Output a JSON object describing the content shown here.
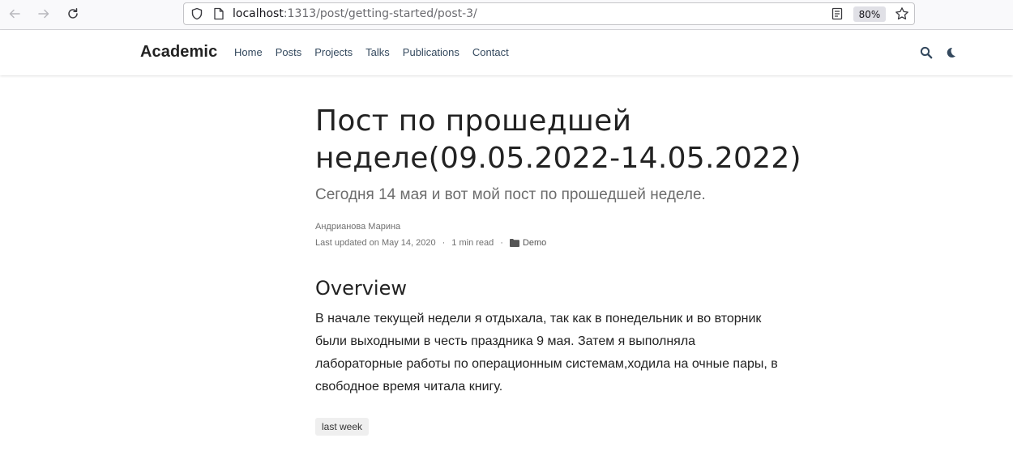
{
  "browser": {
    "url_host": "localhost",
    "url_path": ":1313/post/getting-started/post-3/",
    "zoom": "80%",
    "icons": [
      "back-icon",
      "forward-icon",
      "reload-icon",
      "shield-icon",
      "page-icon",
      "reader-view-icon",
      "bookmark-star-icon"
    ]
  },
  "site": {
    "brand": "Academic",
    "menu": [
      "Home",
      "Posts",
      "Projects",
      "Talks",
      "Publications",
      "Contact"
    ],
    "icons": [
      "search-icon",
      "moon-icon"
    ]
  },
  "article": {
    "title": "Пост по прошедшей неделе(09.05.2022-14.05.2022)",
    "subtitle": "Сегодня 14 мая и вот мой пост по прошедшей неделе.",
    "author": "Андрианова Марина",
    "updated": "Last updated on May 14, 2020",
    "read_time": "1 min read",
    "separator": "·",
    "category": "Demo",
    "section_heading": "Overview",
    "body": "В начале текущей недели я отдыхала, так как в понедельник и во вторник были выходными в честь праздника 9 мая. Затем я выполняла лабораторные работы по операционным системам,ходила на очные пары, в свободное время читала книгу.",
    "tag": "last week"
  }
}
